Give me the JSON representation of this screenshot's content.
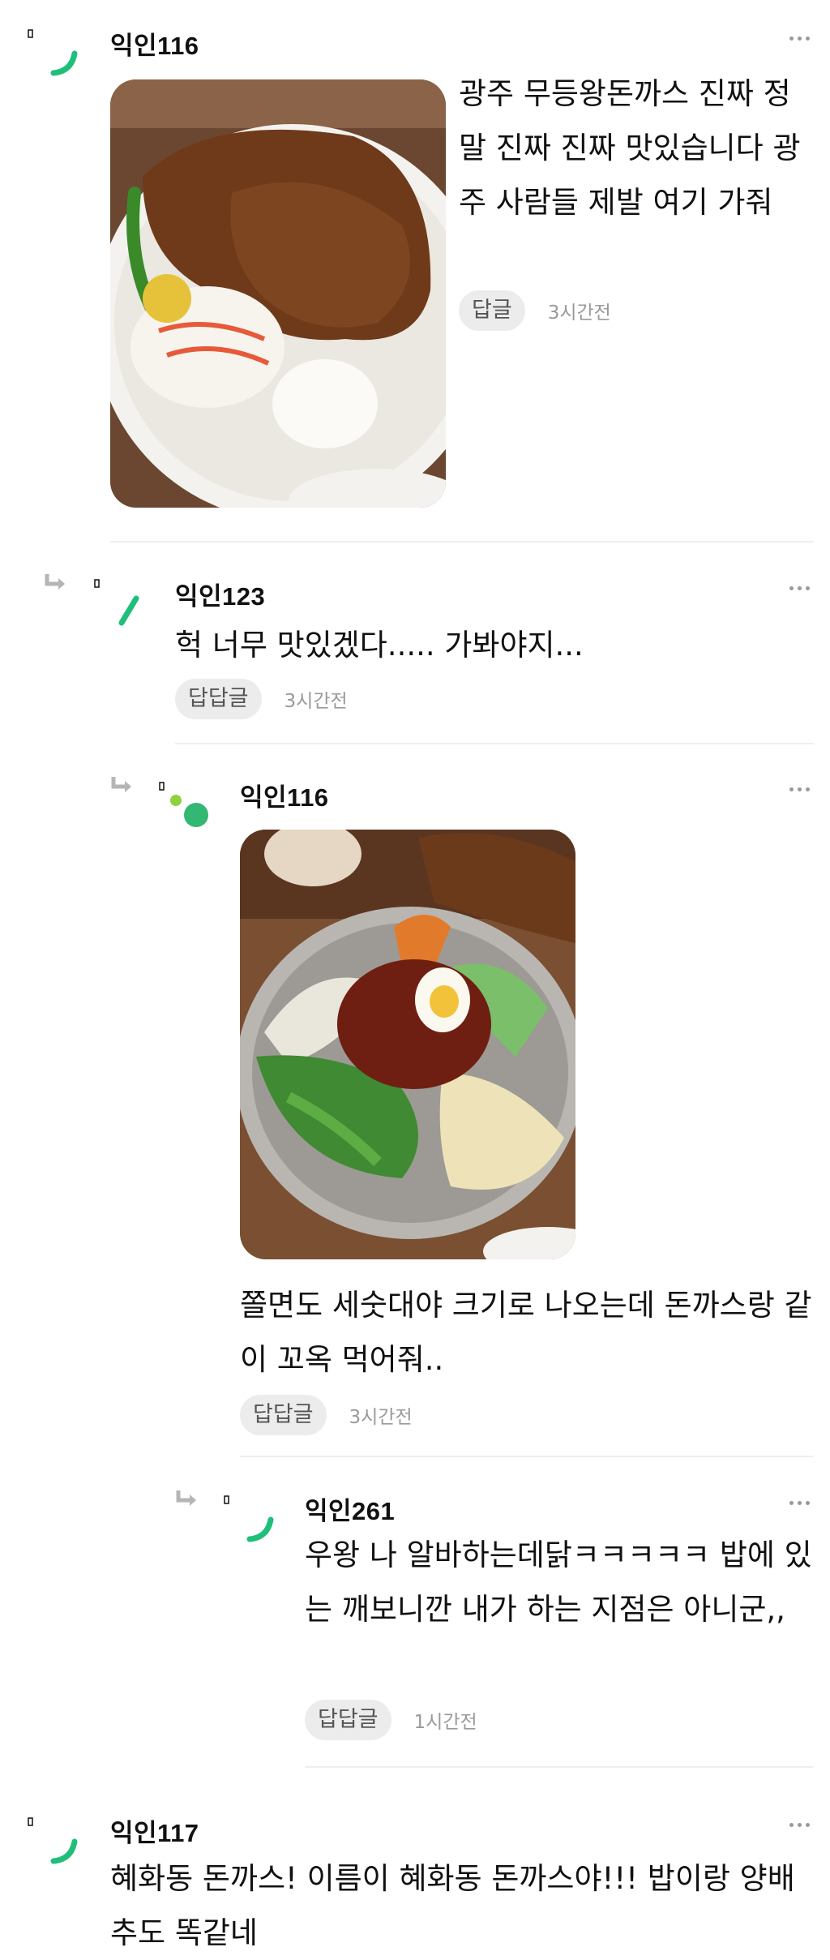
{
  "comments": [
    {
      "author": "익인116",
      "text": "광주 무등왕돈까스 진짜 정말 진짜 진짜 맛있습니다 광주 사람들 제발 여기 가줘",
      "reply_label": "답글",
      "time": "3시간전",
      "photo": "donkatsu-plate-photo"
    },
    {
      "author": "익인123",
      "text": "헉 너무 맛있겠다..... 가봐야지...",
      "reply_label": "답답글",
      "time": "3시간전"
    },
    {
      "author": "익인116",
      "text": "쫄면도 세숫대야 크기로 나오는데 돈까스랑 같이 꼬옥 먹어줘..",
      "reply_label": "답답글",
      "time": "3시간전",
      "photo": "jjolmyeon-bowl-photo"
    },
    {
      "author": "익인261",
      "text": "우왕 나 알바하는데닭ㅋㅋㅋㅋㅋ 밥에 있는 깨보니깐 내가 하는 지점은 아니군,,",
      "reply_label": "답답글",
      "time": "1시간전"
    },
    {
      "author": "익인117",
      "text": "혜화동 돈까스! 이름이 혜화동 돈까스야!!! 밥이랑 양배추도 똑같네"
    }
  ],
  "icons": {
    "more": "more-dots-icon",
    "reply": "reply-arrow-icon",
    "avatar": "anonymous-avatar-icon"
  },
  "colors": {
    "accent_green": "#1fbf7a",
    "light_green": "#8fd13f",
    "dot_green": "#33b874",
    "badge_bg": "#ececec",
    "meta_gray": "#9a9a9a"
  }
}
